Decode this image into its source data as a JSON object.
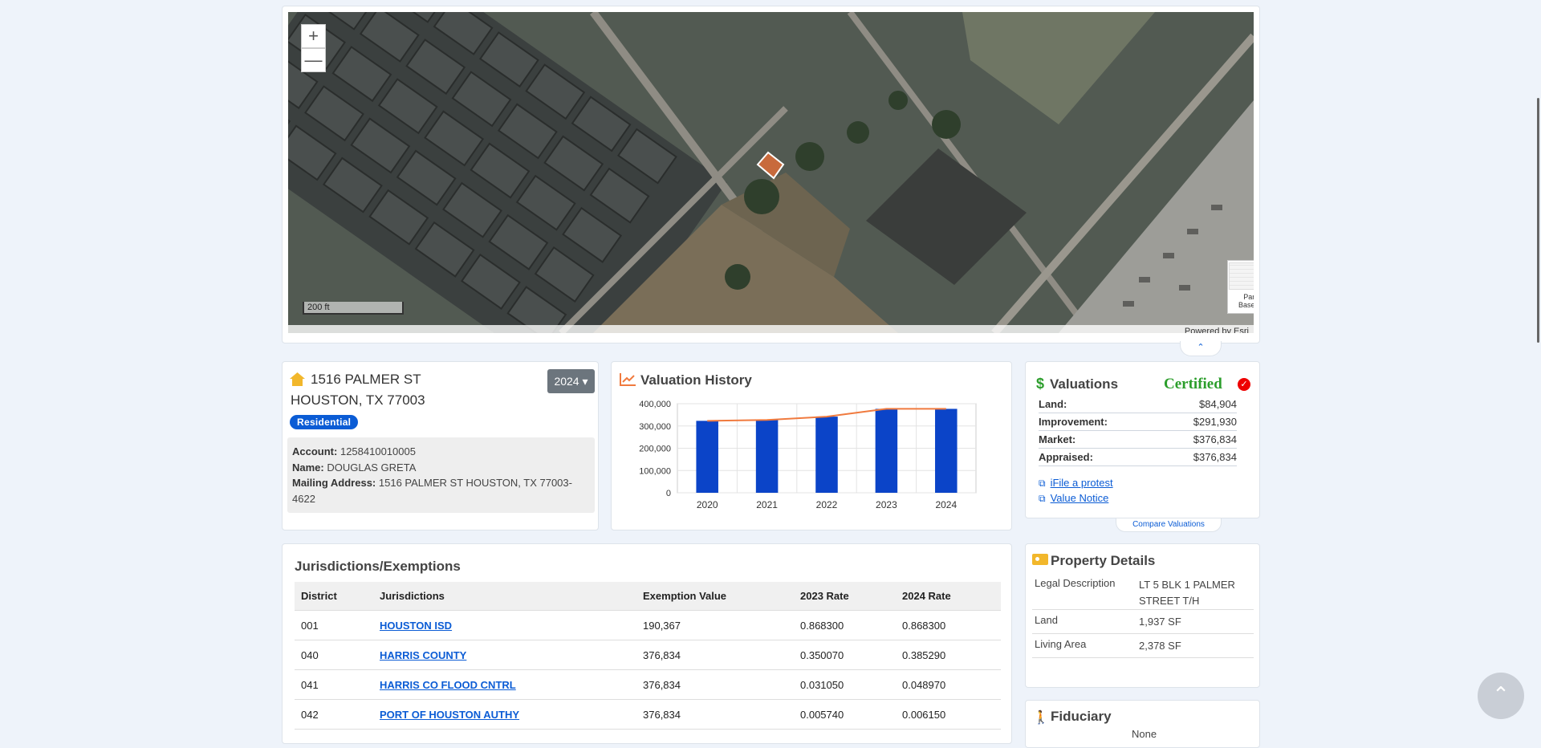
{
  "map": {
    "zoom_in": "+",
    "zoom_out": "—",
    "scale": "200 ft",
    "basemap_line1": "Parcel",
    "basemap_line2": "Basemap",
    "attribution": "Powered by Esri",
    "collapse_glyph": "⌃"
  },
  "property": {
    "address_line1": "1516 PALMER ST",
    "address_line2": "HOUSTON, TX 77003",
    "year": "2024",
    "type": "Residential",
    "account_label": "Account:",
    "account": "1258410010005",
    "name_label": "Name:",
    "name": "DOUGLAS GRETA",
    "mailing_label": "Mailing Address:",
    "mailing": "1516 PALMER ST HOUSTON, TX 77003-4622"
  },
  "history": {
    "title": "Valuation History",
    "chart_data": {
      "type": "bar",
      "categories": [
        "2020",
        "2021",
        "2022",
        "2023",
        "2024"
      ],
      "series": [
        {
          "type": "bar",
          "values": [
            323000,
            327000,
            342000,
            376834,
            376834
          ],
          "color": "#0b44c8"
        },
        {
          "type": "line",
          "values": [
            323000,
            327000,
            342000,
            376834,
            376834
          ],
          "color": "#f07a3e"
        }
      ],
      "y_ticks": [
        "400,000",
        "300,000",
        "200,000",
        "100,000",
        "0"
      ],
      "ylim": [
        0,
        400000
      ],
      "grid": true
    }
  },
  "valuations": {
    "title": "Valuations",
    "status": "Certified",
    "rows": [
      {
        "label": "Land:",
        "value": "$84,904"
      },
      {
        "label": "Improvement:",
        "value": "$291,930"
      },
      {
        "label": "Market:",
        "value": "$376,834"
      },
      {
        "label": "Appraised:",
        "value": "$376,834"
      }
    ],
    "links": [
      "iFile a protest",
      "Value Notice"
    ],
    "compare": "Compare Valuations"
  },
  "jurisdictions": {
    "title": "Jurisdictions/Exemptions",
    "headers": [
      "District",
      "Jurisdictions",
      "Exemption Value",
      "2023 Rate",
      "2024 Rate"
    ],
    "rows": [
      {
        "district": "001",
        "name": "HOUSTON ISD",
        "exemption": "190,367",
        "rate2023": "0.868300",
        "rate2024": "0.868300"
      },
      {
        "district": "040",
        "name": "HARRIS COUNTY",
        "exemption": "376,834",
        "rate2023": "0.350070",
        "rate2024": "0.385290"
      },
      {
        "district": "041",
        "name": "HARRIS CO FLOOD CNTRL",
        "exemption": "376,834",
        "rate2023": "0.031050",
        "rate2024": "0.048970"
      },
      {
        "district": "042",
        "name": "PORT OF HOUSTON AUTHY",
        "exemption": "376,834",
        "rate2023": "0.005740",
        "rate2024": "0.006150"
      }
    ]
  },
  "details": {
    "title": "Property Details",
    "rows": [
      {
        "key": "Legal Description",
        "value": "LT 5 BLK 1 PALMER STREET T/H"
      },
      {
        "key": "Land",
        "value": "1,937 SF"
      },
      {
        "key": "Living Area",
        "value": "2,378 SF"
      }
    ]
  },
  "fiduciary": {
    "title": "Fiduciary",
    "value": "None"
  },
  "colors": {
    "accent": "#0b5cd5",
    "certified": "#2c9e2c",
    "bar": "#0b44c8",
    "line": "#f07a3e"
  }
}
